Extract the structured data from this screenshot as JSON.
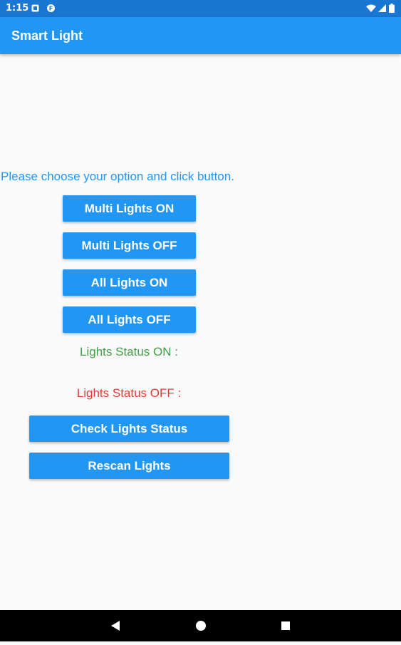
{
  "status_bar": {
    "time": "1:15",
    "icons": [
      "notification-square-icon",
      "app-badge-icon",
      "wifi-icon",
      "signal-icon",
      "battery-icon"
    ],
    "background": "#1976d2"
  },
  "app_bar": {
    "title": "Smart Light",
    "background": "#2196f3"
  },
  "main": {
    "prompt": "Please choose your option and click button.",
    "buttons": {
      "multi_on": "Multi Lights ON",
      "multi_off": "Multi Lights OFF",
      "all_on": "All Lights ON",
      "all_off": "All Lights OFF",
      "check_status": "Check Lights Status",
      "rescan": "Rescan Lights"
    },
    "status_on": "Lights Status ON :",
    "status_off": "Lights Status OFF :",
    "colors": {
      "accent": "#2196f3",
      "on": "#43a047",
      "off": "#e53935"
    }
  },
  "nav_bar": {
    "icons": [
      "back-triangle-icon",
      "home-circle-icon",
      "recents-square-icon"
    ]
  }
}
